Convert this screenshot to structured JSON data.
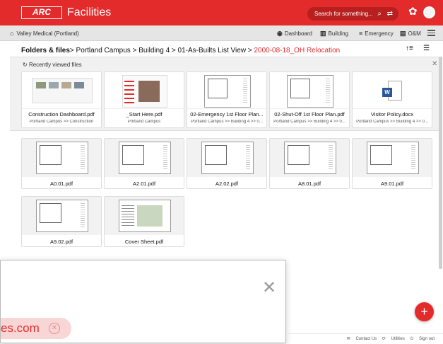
{
  "header": {
    "logo_text": "ARC",
    "brand": "Facilities",
    "search_placeholder": "Search for something...",
    "accent_color": "#e32b2b"
  },
  "subnav": {
    "facility": "Valley Medical (Portland)",
    "items": [
      "Dashboard",
      "Building",
      "Emergency",
      "O&M"
    ]
  },
  "breadcrumb": {
    "root": "Folders & files",
    "parts": [
      "Portland Campus",
      "Building 4",
      "01-As-Builts List View"
    ],
    "current": "2000-08-18_OH Relocation"
  },
  "recently_viewed": {
    "title": "Recently viewed files",
    "files": [
      {
        "name": "Construction Dashboard.pdf",
        "path": "Portland Campus >> Construction"
      },
      {
        "name": "_Start Here.pdf",
        "path": "Portland Campus"
      },
      {
        "name": "02-Emergency 1st Floor Plan...",
        "path": "Portland Campus >> Building 4 >> 0..."
      },
      {
        "name": "02-Shut-Off 1st Floor Plan.pdf",
        "path": "Portland Campus >> Building 4 >> 0..."
      },
      {
        "name": "Visitor Policy.docx",
        "path": "Portland Campus >> Building 4 >> 0..."
      }
    ]
  },
  "files": [
    "A0.01.pdf",
    "A2.01.pdf",
    "A2.02.pdf",
    "A8.01.pdf",
    "A9.01.pdf",
    "A9.02.pdf",
    "Cover Sheet.pdf"
  ],
  "overlay": {
    "pill_text": "es.com"
  },
  "footer": {
    "contact": "Contact Us",
    "utilities": "Utilities",
    "signout": "Sign out"
  }
}
